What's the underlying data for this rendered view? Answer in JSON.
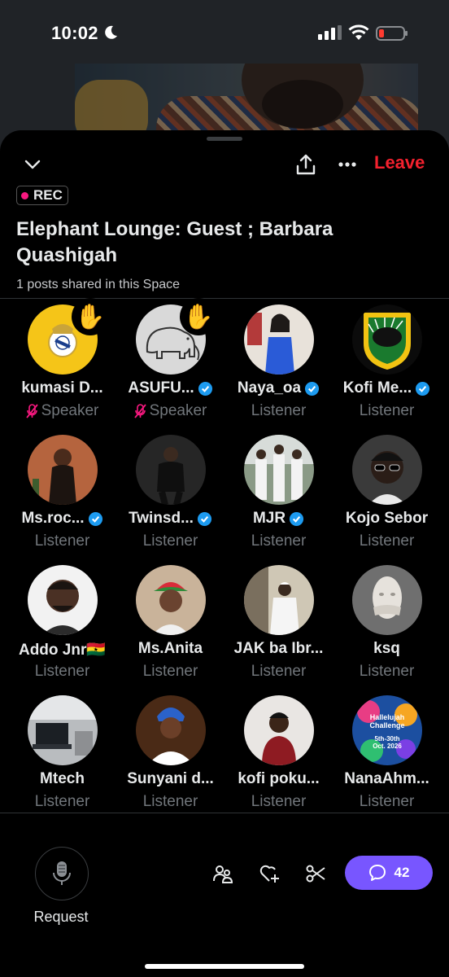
{
  "status_bar": {
    "time": "10:02"
  },
  "header": {
    "leave_label": "Leave",
    "rec_label": "REC",
    "title": "Elephant Lounge: Guest ; Barbara Quashigah",
    "posts_shared": "1 posts shared in this Space"
  },
  "participants": [
    {
      "name": "kumasi D...",
      "role": "Speaker",
      "verified": false,
      "hand_raised": true,
      "mic_muted": true,
      "avatar_icon": "real-madrid-crest"
    },
    {
      "name": "ASUFU...",
      "role": "Speaker",
      "verified": true,
      "hand_raised": true,
      "mic_muted": true,
      "avatar_icon": "elephant-sketch"
    },
    {
      "name": "Naya_oa",
      "role": "Listener",
      "verified": true,
      "hand_raised": false,
      "avatar_icon": "woman-blue-dress"
    },
    {
      "name": "Kofi Me...",
      "role": "Listener",
      "verified": true,
      "hand_raised": false,
      "avatar_icon": "asante-kotoko-crest"
    },
    {
      "name": "Ms.roc...",
      "role": "Listener",
      "verified": true,
      "hand_raised": false,
      "avatar_icon": "woman-portrait"
    },
    {
      "name": "Twinsd...",
      "role": "Listener",
      "verified": true,
      "hand_raised": false,
      "avatar_icon": "man-black-jacket"
    },
    {
      "name": "MJR",
      "role": "Listener",
      "verified": true,
      "hand_raised": false,
      "avatar_icon": "group-white-outfits"
    },
    {
      "name": "Kojo Sebor",
      "role": "Listener",
      "verified": false,
      "hand_raised": false,
      "avatar_icon": "man-glasses"
    },
    {
      "name": "Addo Jnr🇬🇭",
      "role": "Listener",
      "verified": false,
      "hand_raised": false,
      "avatar_icon": "man-portrait"
    },
    {
      "name": "Ms.Anita",
      "role": "Listener",
      "verified": false,
      "hand_raised": false,
      "avatar_icon": "woman-cap"
    },
    {
      "name": "JAK ba Ibr...",
      "role": "Listener",
      "verified": false,
      "hand_raised": false,
      "avatar_icon": "man-white-robe"
    },
    {
      "name": "ksq",
      "role": "Listener",
      "verified": false,
      "hand_raised": false,
      "avatar_icon": "mask-face"
    },
    {
      "name": "Mtech",
      "role": "Listener",
      "verified": false,
      "hand_raised": false,
      "avatar_icon": "laptop-desk"
    },
    {
      "name": "Sunyani d...",
      "role": "Listener",
      "verified": false,
      "hand_raised": false,
      "avatar_icon": "woman-headwrap"
    },
    {
      "name": "kofi poku...",
      "role": "Listener",
      "verified": false,
      "hand_raised": false,
      "avatar_icon": "man-red-hoodie"
    },
    {
      "name": "NanaAhm...",
      "role": "Listener",
      "verified": false,
      "hand_raised": false,
      "avatar_icon": "hallelujah-challenge-flyer"
    }
  ],
  "hallelujah_flyer": {
    "line1": "Hallelujah",
    "line2": "Challenge",
    "line3": "5th-30th",
    "line4": "Oct. 2026"
  },
  "bottom_bar": {
    "request_label": "Request",
    "comment_count": "42"
  },
  "colors": {
    "accent_purple": "#7856ff",
    "leave_red": "#f4212e",
    "rec_pink": "#f91880",
    "verified_blue": "#1d9bf0",
    "muted_text": "#71767b"
  }
}
